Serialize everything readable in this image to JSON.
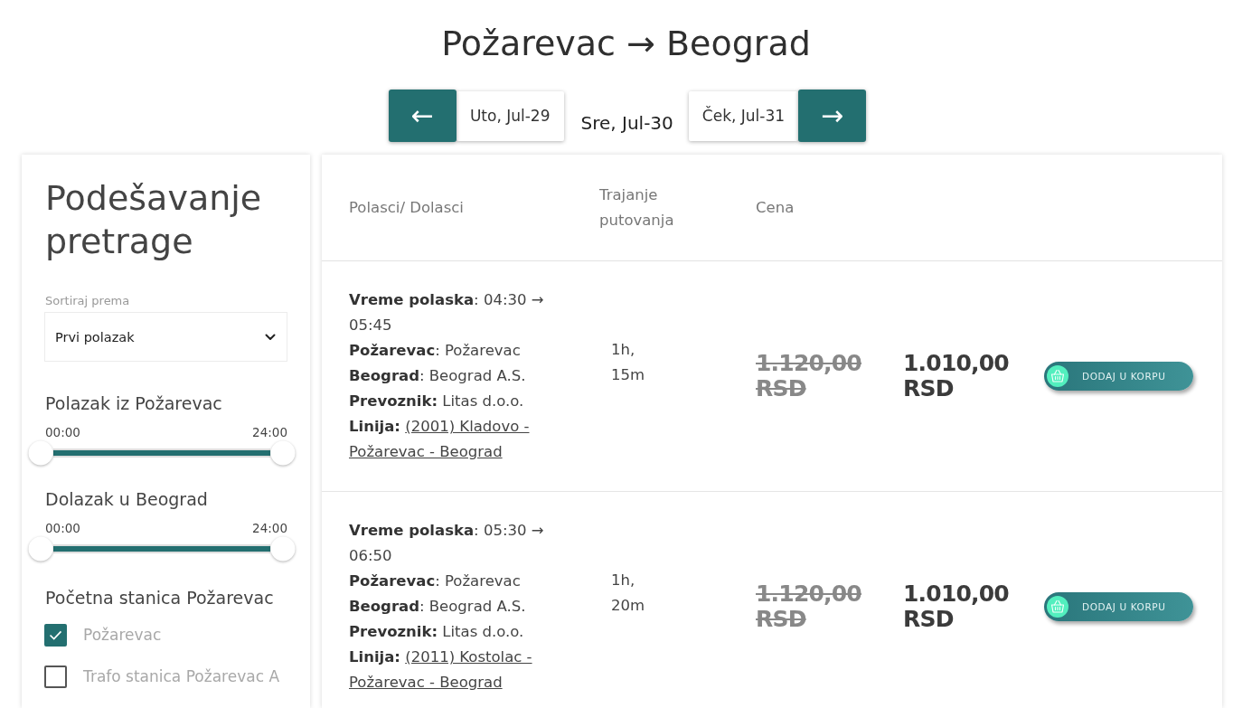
{
  "title": "Požarevac → Beograd",
  "date_nav": {
    "prev_button": "←",
    "dates": [
      {
        "label": "Uto, Jul-29",
        "selected": false
      },
      {
        "label": "Sre, Jul-30",
        "selected": true
      },
      {
        "label": "Ček, Jul-31",
        "selected": false
      }
    ],
    "next_button": "→"
  },
  "sidebar": {
    "title": "Podešavanje pretrage",
    "sort": {
      "label": "Sortiraj prema",
      "value": "Prvi polazak"
    },
    "sliders": [
      {
        "label": "Polazak iz Požarevac",
        "min_label": "00:00",
        "max_label": "24:00",
        "level": 1
      },
      {
        "label": "Dolazak u Beograd",
        "min_label": "00:00",
        "max_label": "24:00",
        "level": 1
      }
    ],
    "stations": {
      "heading": "Početna stanica Požarevac",
      "items": [
        {
          "label": "Požarevac",
          "checked": true
        },
        {
          "label": "Trafo stanica Požarevac A",
          "checked": false
        }
      ]
    }
  },
  "table": {
    "columns": [
      "Polasci/ Dolasci",
      "Trajanje putovanja",
      "Cena"
    ],
    "rows": [
      {
        "departure": "**Vreme polaska**: 04:30 → 05:45",
        "origin": "**Požarevac**: Požarevac",
        "destination": "**Beograd**: Beograd A.S.",
        "carrier": "**Prevoznik:** Litas d.o.o.",
        "route": {
          "label": "Linija:",
          "link": "(2001) Kladovo - Požarevac - Beograd"
        },
        "duration": "1h, 15m",
        "old_price": "1.120,00 RSD",
        "price": "1.010,00 RSD",
        "button": "DODAJ U KORPU"
      },
      {
        "departure": "**Vreme polaska**: 05:30 → 06:50",
        "origin": "**Požarevac**: Požarevac",
        "destination": "**Beograd**: Beograd A.S.",
        "carrier": "**Prevoznik:** Litas d.o.o.",
        "route": {
          "label": "Linija:",
          "link": "(2011) Kostolac - Požarevac - Beograd"
        },
        "duration": "1h, 20m",
        "old_price": "1.120,00 RSD",
        "price": "1.010,00 RSD",
        "button": "DODAJ U KORPU"
      }
    ]
  }
}
